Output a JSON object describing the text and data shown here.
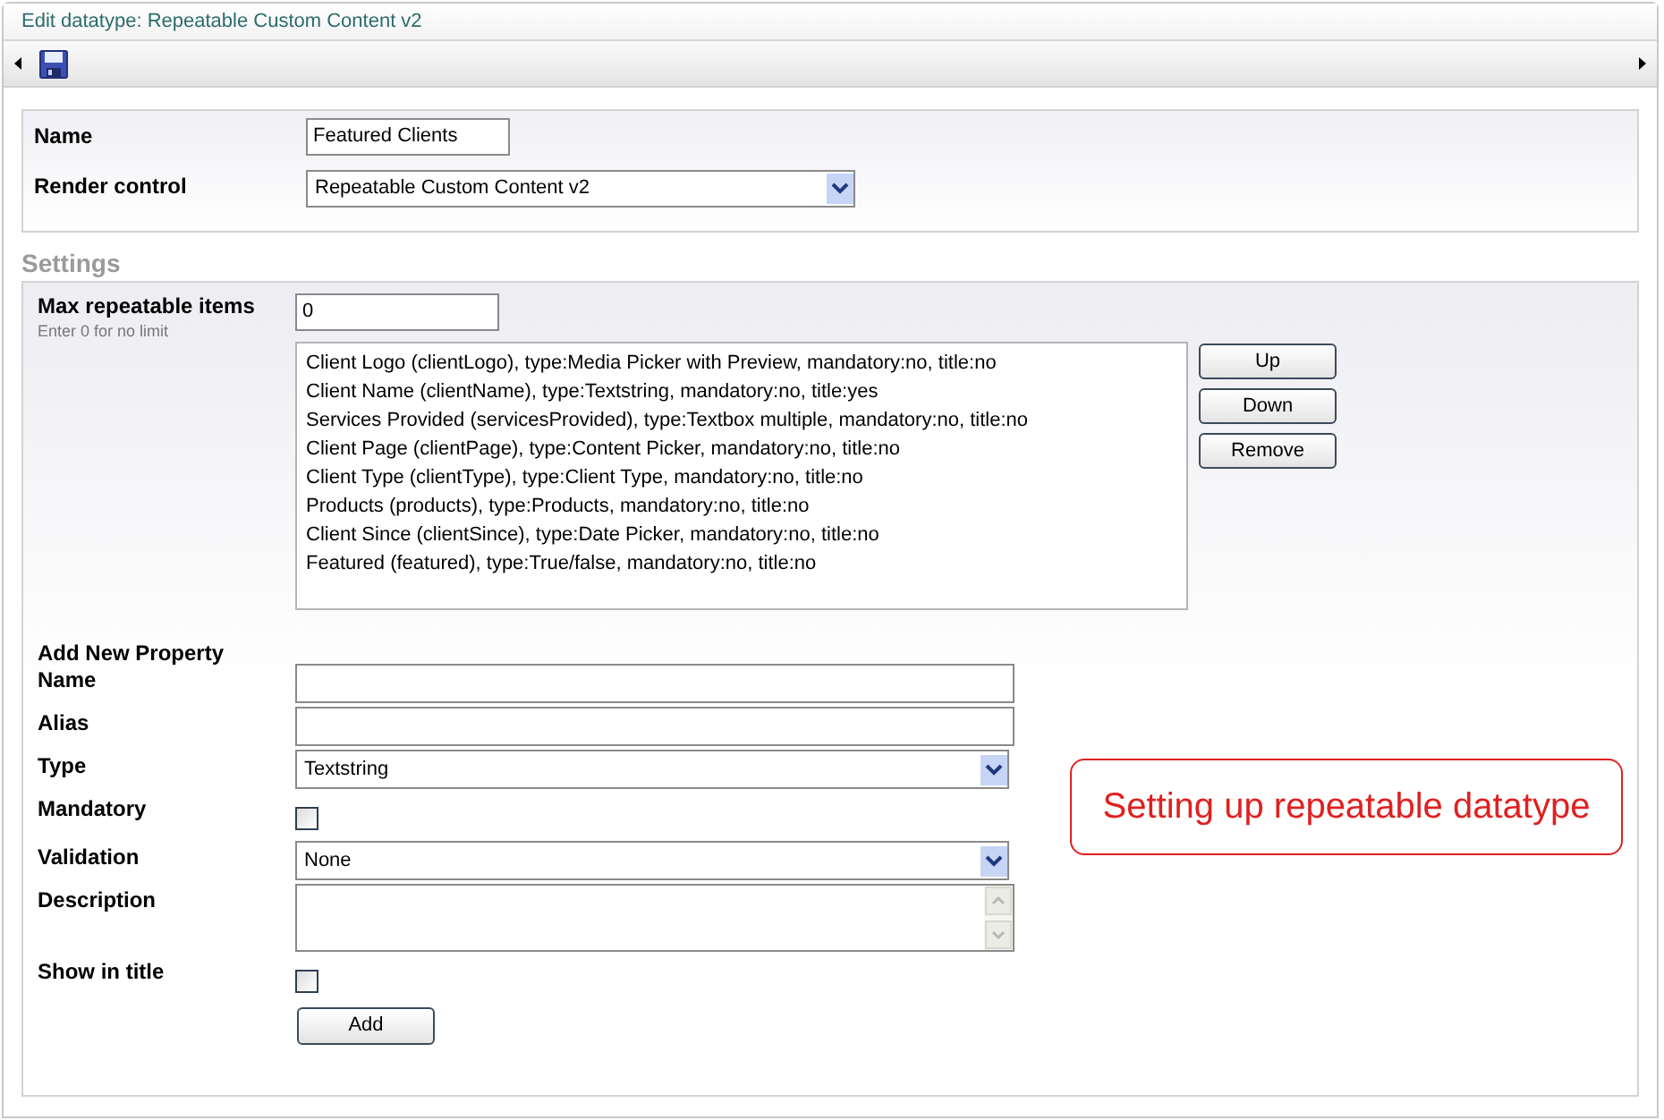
{
  "window": {
    "title": "Edit datatype: Repeatable Custom Content v2"
  },
  "general": {
    "name": {
      "label": "Name",
      "value": "Featured Clients"
    },
    "render_control": {
      "label": "Render control",
      "value": "Repeatable Custom Content v2"
    }
  },
  "settings": {
    "heading": "Settings",
    "max_items": {
      "label": "Max repeatable items",
      "hint": "Enter 0 for no limit",
      "value": "0"
    },
    "properties": [
      "Client Logo (clientLogo), type:Media Picker with Preview, mandatory:no, title:no",
      "Client Name (clientName), type:Textstring, mandatory:no, title:yes",
      "Services Provided (servicesProvided), type:Textbox multiple, mandatory:no, title:no",
      "Client Page (clientPage), type:Content Picker, mandatory:no, title:no",
      "Client Type (clientType), type:Client Type, mandatory:no, title:no",
      "Products (products), type:Products, mandatory:no, title:no",
      "Client Since (clientSince), type:Date Picker, mandatory:no, title:no",
      "Featured (featured), type:True/false, mandatory:no, title:no"
    ],
    "list_buttons": [
      "Up",
      "Down",
      "Remove"
    ],
    "add_heading": "Add New Property",
    "add_fields": [
      {
        "kind": "text",
        "label": "Name"
      },
      {
        "kind": "text",
        "label": "Alias"
      },
      {
        "kind": "select",
        "label": "Type",
        "value": "Textstring"
      },
      {
        "kind": "checkbox",
        "label": "Mandatory",
        "checked": false
      },
      {
        "kind": "select",
        "label": "Validation",
        "value": "None"
      },
      {
        "kind": "textarea",
        "label": "Description"
      },
      {
        "kind": "checkbox",
        "label": "Show in title",
        "checked": false
      }
    ],
    "add_button": "Add"
  },
  "callout": "Setting up repeatable datatype"
}
